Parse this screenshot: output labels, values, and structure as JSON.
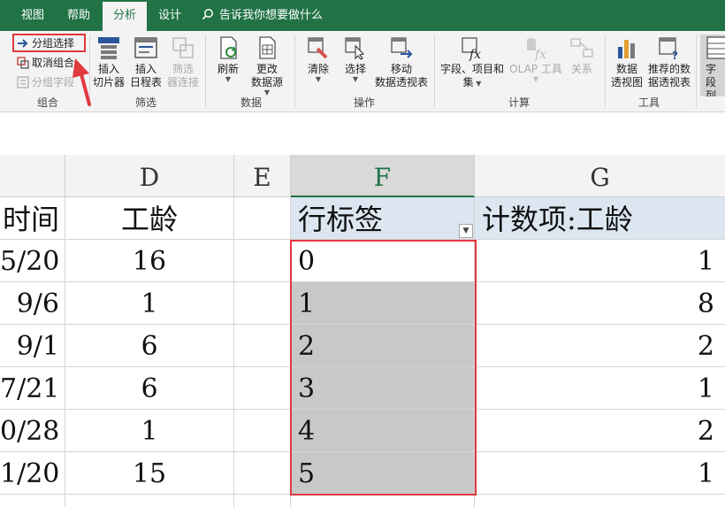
{
  "tabs": [
    {
      "label": "视图",
      "active": false
    },
    {
      "label": "帮助",
      "active": false
    },
    {
      "label": "分析",
      "active": true
    },
    {
      "label": "设计",
      "active": false
    }
  ],
  "tell_me": "告诉我你想要做什么",
  "ribbon": {
    "group_group": {
      "label": "组合",
      "group_selection": "分组选择",
      "ungroup": "取消组合",
      "group_field": "分组字段"
    },
    "group_filter": {
      "label": "筛选",
      "insert_slicer": [
        "插入",
        "切片器"
      ],
      "insert_timeline": [
        "插入",
        "日程表"
      ],
      "filter_connections": [
        "筛选",
        "器连接"
      ]
    },
    "group_data": {
      "label": "数据",
      "refresh": [
        "刷新"
      ],
      "change_source": [
        "更改",
        "数据源"
      ]
    },
    "group_actions": {
      "label": "操作",
      "clear": [
        "清除"
      ],
      "select": [
        "选择"
      ],
      "move": [
        "移动",
        "数据透视表"
      ]
    },
    "group_calc": {
      "label": "计算",
      "fields_items": [
        "字段、项目和",
        "集"
      ],
      "olap_tools": [
        "OLAP 工具"
      ],
      "relations": [
        "关系"
      ]
    },
    "group_tools": {
      "label": "工具",
      "pivot_chart": [
        "数据",
        "透视图"
      ],
      "recommended": [
        "推荐的数",
        "据透视表"
      ]
    },
    "group_show": {
      "field_list": [
        "字段",
        "列表"
      ]
    }
  },
  "columns": [
    "",
    "D",
    "E",
    "F",
    "G"
  ],
  "table": {
    "header": {
      "c": "时间",
      "d": "工龄",
      "f": "行标签",
      "g": "计数项:工龄"
    },
    "rows": [
      {
        "c": "5/20",
        "d": "16",
        "f": "0",
        "g": "1"
      },
      {
        "c": "9/6",
        "d": "1",
        "f": "1",
        "g": "8"
      },
      {
        "c": "9/1",
        "d": "6",
        "f": "2",
        "g": "2"
      },
      {
        "c": "7/21",
        "d": "6",
        "f": "3",
        "g": "1"
      },
      {
        "c": "0/28",
        "d": "1",
        "f": "4",
        "g": "2"
      },
      {
        "c": "1/20",
        "d": "15",
        "f": "5",
        "g": "1"
      }
    ]
  },
  "colors": {
    "excel_green": "#217346",
    "highlight_red": "#e0393e",
    "pivot_header": "#dce6f1",
    "selected_gray": "#c8c8c8"
  }
}
